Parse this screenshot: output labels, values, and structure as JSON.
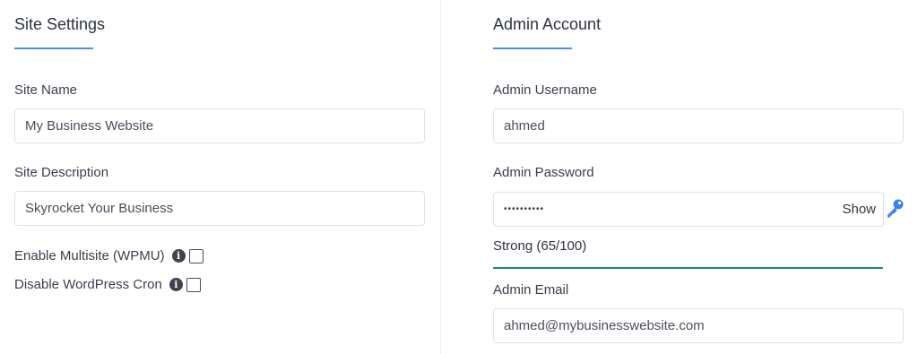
{
  "site_settings": {
    "title": "Site Settings",
    "site_name": {
      "label": "Site Name",
      "value": "My Business Website"
    },
    "site_description": {
      "label": "Site Description",
      "value": "Skyrocket Your Business"
    },
    "checkboxes": [
      {
        "label": "Enable Multisite (WPMU)",
        "checked": false,
        "info_icon": "info-icon"
      },
      {
        "label": "Disable WordPress Cron",
        "checked": false,
        "info_icon": "info-icon"
      }
    ]
  },
  "admin_account": {
    "title": "Admin Account",
    "username": {
      "label": "Admin Username",
      "value": "ahmed"
    },
    "password": {
      "label": "Admin Password",
      "masked_value": "••••••••••",
      "show_label": "Show",
      "generate_icon": "key-icon"
    },
    "strength": {
      "text": "Strong (65/100)",
      "score": 65,
      "color": "#1a8a7a"
    },
    "email": {
      "label": "Admin Email",
      "value": "ahmed@mybusinesswebsite.com"
    }
  },
  "colors": {
    "accent": "#4f8fe6",
    "strength_bar": "#1a8a7a",
    "key_icon": "#3b82f6"
  }
}
